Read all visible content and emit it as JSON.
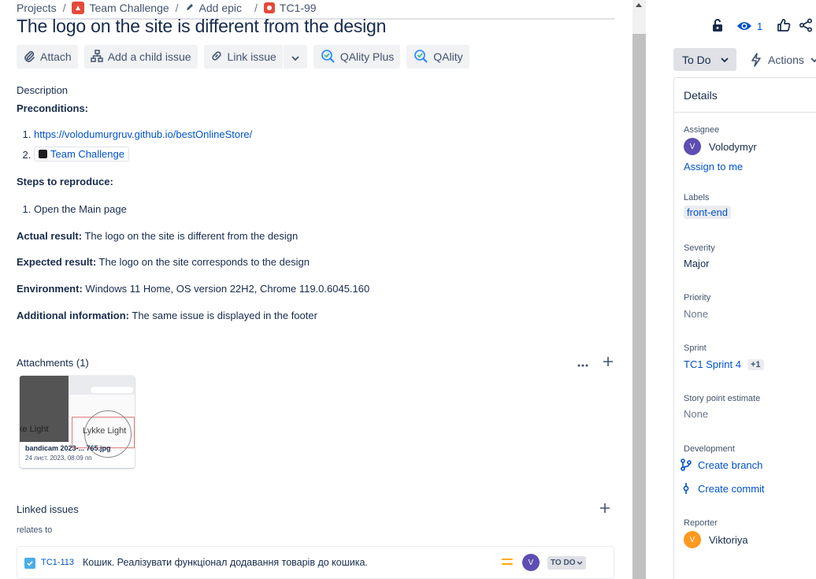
{
  "breadcrumb": {
    "projects": "Projects",
    "project": "Team Challenge",
    "epic": "Add epic",
    "issue_key": "TC1-99"
  },
  "issue": {
    "title": "The logo on the site is different from the design"
  },
  "toolbar": {
    "attach": "Attach",
    "add_child": "Add a child issue",
    "link_issue": "Link issue",
    "qality_plus": "QAlity Plus",
    "qality": "QAlity"
  },
  "description": {
    "label": "Description",
    "preconditions_label": "Preconditions:",
    "precondition_link": "https://volodumurgruv.github.io/bestOnlineStore/",
    "precondition_project": "Team Challenge",
    "steps_label": "Steps to reproduce:",
    "steps": [
      "Open the Main page"
    ],
    "actual_label": "Actual result:",
    "actual_value": "The logo on the site is different from the design",
    "expected_label": "Expected result:",
    "expected_value": "The logo on the site corresponds to the design",
    "environment_label": "Environment:",
    "environment_value": "Windows 11 Home, OS version 22H2, Chrome 119.0.6045.160",
    "additional_label": "Additional information:",
    "additional_value": "The same issue is displayed in the footer"
  },
  "attachments": {
    "header": "Attachments (1)",
    "items": [
      {
        "filename": "bandicam 2023-... 765.jpg",
        "date": "24 лист. 2023, 08:09 пп",
        "preview_text_left": "ke Light",
        "preview_text_right": "Lykke Light"
      }
    ]
  },
  "linked_issues": {
    "header": "Linked issues",
    "relation": "relates to",
    "items": [
      {
        "key": "TC1-113",
        "summary": "Кошик. Реалізувати функціонал додавання товарів до кошика.",
        "assignee_initial": "V",
        "status": "TO DO"
      }
    ]
  },
  "sidebar": {
    "watchers_count": "1",
    "status": "To Do",
    "actions": "Actions",
    "details_header": "Details",
    "assignee_label": "Assignee",
    "assignee_initial": "V",
    "assignee_name": "Volodymyr",
    "assign_to_me": "Assign to me",
    "labels_label": "Labels",
    "labels": [
      "front-end"
    ],
    "severity_label": "Severity",
    "severity_value": "Major",
    "priority_label": "Priority",
    "priority_value": "None",
    "sprint_label": "Sprint",
    "sprint_value": "TC1 Sprint 4",
    "sprint_more": "+1",
    "story_points_label": "Story point estimate",
    "story_points_value": "None",
    "development_label": "Development",
    "create_branch": "Create branch",
    "create_commit": "Create commit",
    "reporter_label": "Reporter",
    "reporter_initial": "V",
    "reporter_name": "Viktoriya"
  },
  "colors": {
    "accent": "#0052cc",
    "assignee_avatar": "#5e4db2",
    "reporter_avatar": "#ff991f",
    "bug_icon": "#e5493a",
    "story_icon": "#4bade8",
    "priority_medium": "#ffab00"
  }
}
